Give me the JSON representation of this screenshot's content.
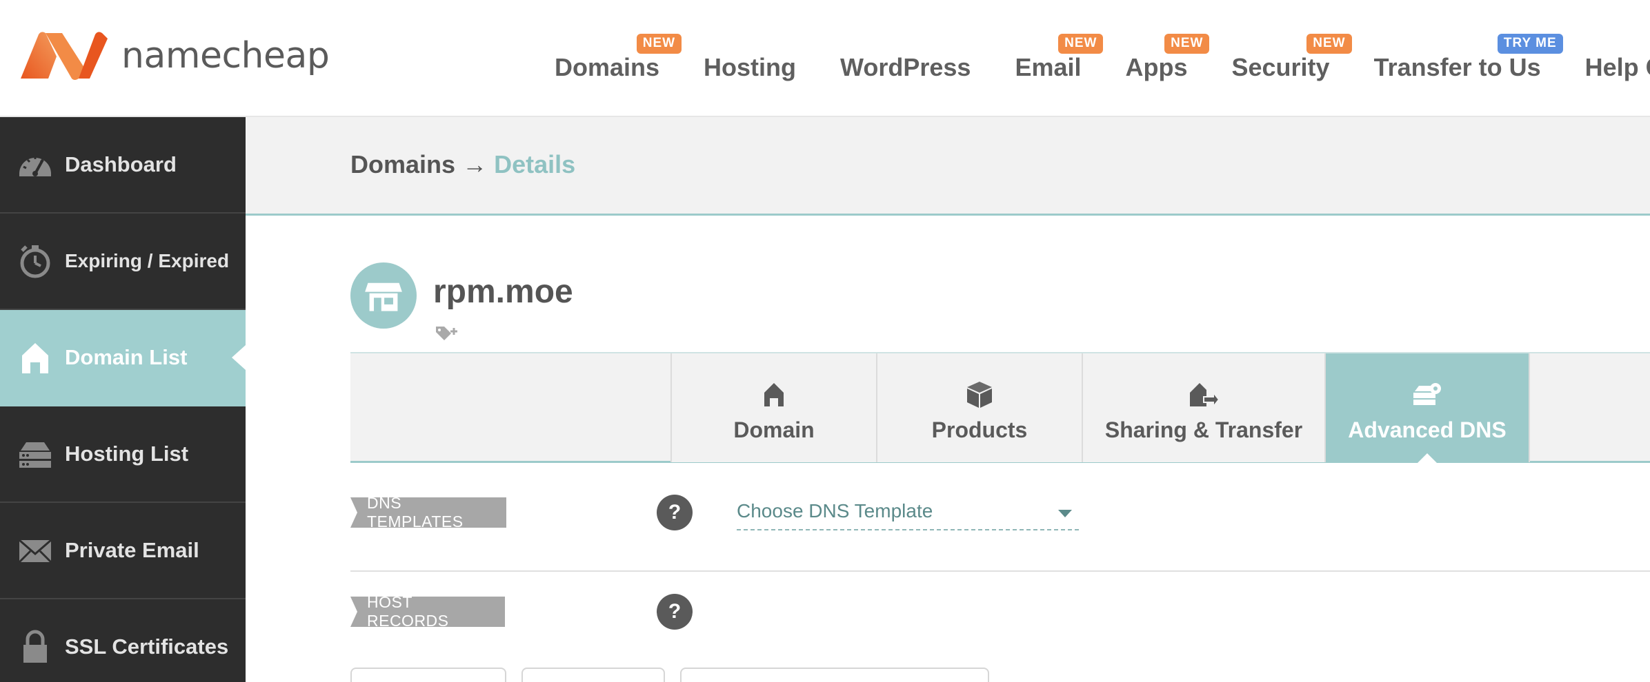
{
  "brand": {
    "name": "namecheap"
  },
  "nav": [
    {
      "label": "Domains",
      "badge": "NEW",
      "badge_color": "#f28b46"
    },
    {
      "label": "Hosting",
      "badge": ""
    },
    {
      "label": "WordPress",
      "badge": ""
    },
    {
      "label": "Email",
      "badge": "NEW",
      "badge_color": "#f28b46"
    },
    {
      "label": "Apps",
      "badge": "NEW",
      "badge_color": "#f28b46"
    },
    {
      "label": "Security",
      "badge": "NEW",
      "badge_color": "#f28b46"
    },
    {
      "label": "Transfer to Us",
      "badge": "TRY ME",
      "badge_color": "#5b8fe0"
    },
    {
      "label": "Help Ce",
      "badge": ""
    }
  ],
  "sidebar": {
    "items": [
      {
        "label": "Dashboard",
        "icon": "speedometer-icon"
      },
      {
        "label": "Expiring / Expired",
        "icon": "stopwatch-icon"
      },
      {
        "label": "Domain List",
        "icon": "house-icon",
        "active": true
      },
      {
        "label": "Hosting List",
        "icon": "server-icon"
      },
      {
        "label": "Private Email",
        "icon": "envelope-icon"
      },
      {
        "label": "SSL Certificates",
        "icon": "lock-icon"
      }
    ]
  },
  "breadcrumb": {
    "parent": "Domains",
    "separator": "→",
    "current": "Details"
  },
  "domain": {
    "name": "rpm.moe"
  },
  "tabs": [
    {
      "label": "Domain",
      "icon": "house-icon"
    },
    {
      "label": "Products",
      "icon": "box-icon"
    },
    {
      "label": "Sharing & Transfer",
      "icon": "house-arrow-icon"
    },
    {
      "label": "Advanced DNS",
      "icon": "server-gear-icon",
      "active": true
    }
  ],
  "dns_templates": {
    "label": "DNS TEMPLATES",
    "help": "?",
    "select_placeholder": "Choose DNS Template"
  },
  "host_records": {
    "label": "HOST RECORDS",
    "help": "?"
  },
  "colors": {
    "accent": "#9ccaca",
    "sidebar_bg": "#2d2d2d",
    "badge_orange": "#f28b46",
    "badge_blue": "#5b8fe0"
  }
}
